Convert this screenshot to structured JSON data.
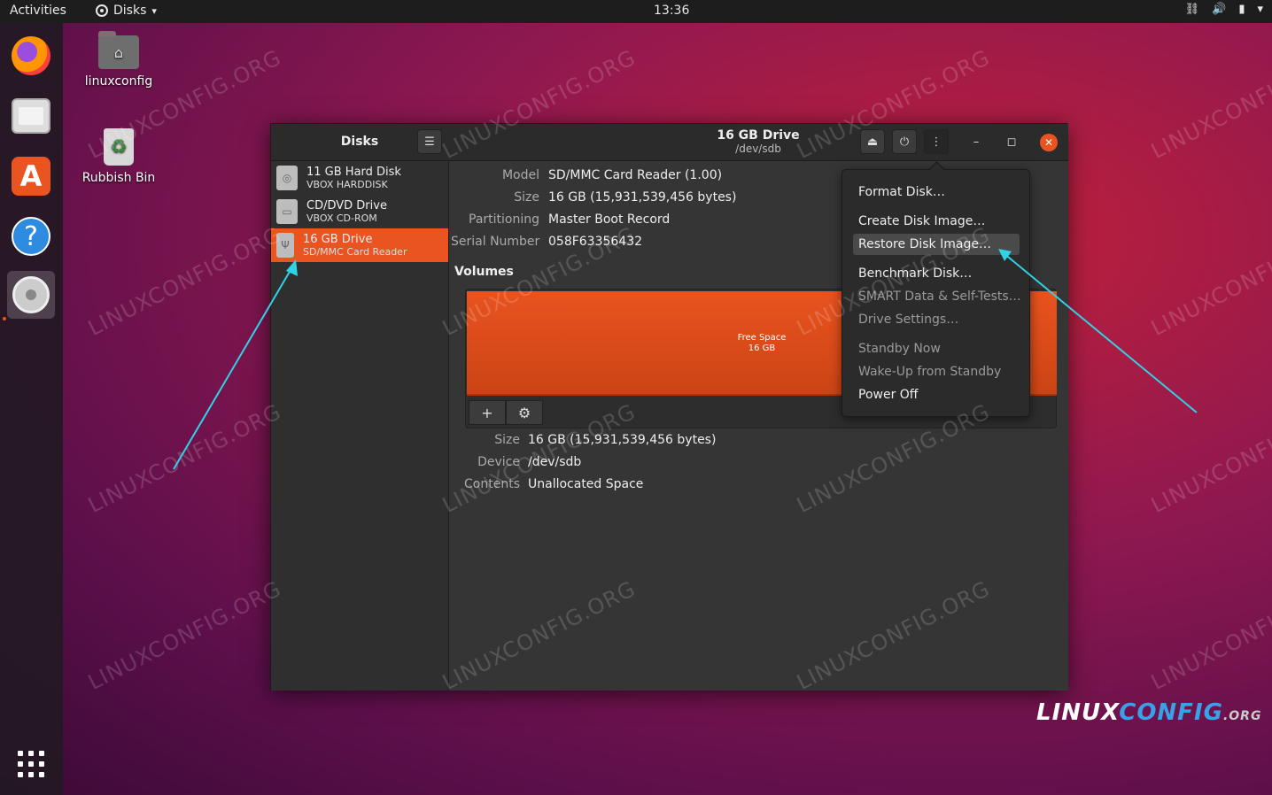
{
  "topbar": {
    "activities": "Activities",
    "app_name": "Disks",
    "app_caret": "▾",
    "clock": "13:36",
    "tray": [
      "⛓",
      "🔊",
      "▮",
      "▾"
    ]
  },
  "desktop": {
    "home_folder_label": "linuxconfig",
    "trash_label": "Rubbish Bin"
  },
  "window": {
    "sidebar_title": "Disks",
    "drive_title": "16 GB Drive",
    "drive_subtitle": "/dev/sdb",
    "drives": [
      {
        "name": "11 GB Hard Disk",
        "desc": "VBOX HARDDISK"
      },
      {
        "name": "CD/DVD Drive",
        "desc": "VBOX CD-ROM"
      },
      {
        "name": "16 GB Drive",
        "desc": "SD/MMC Card  Reader"
      }
    ],
    "drive_props": [
      {
        "key": "Model",
        "value": "SD/MMC Card  Reader (1.00)"
      },
      {
        "key": "Size",
        "value": "16 GB (15,931,539,456 bytes)"
      },
      {
        "key": "Partitioning",
        "value": "Master Boot Record"
      },
      {
        "key": "Serial Number",
        "value": "058F63356432"
      }
    ],
    "volumes_label": "Volumes",
    "volume": {
      "line1": "Free Space",
      "line2": "16 GB"
    },
    "add_symbol": "+",
    "settings_symbol": "⚙",
    "partition_props": [
      {
        "key": "Size",
        "value": "16 GB (15,931,539,456 bytes)"
      },
      {
        "key": "Device",
        "value": "/dev/sdb"
      },
      {
        "key": "Contents",
        "value": "Unallocated Space"
      }
    ],
    "menu_items": [
      {
        "label": "Format Disk…"
      },
      {
        "label": "Create Disk Image…"
      },
      {
        "label": "Restore Disk Image…"
      },
      {
        "label": "Benchmark Disk…"
      },
      {
        "label": "SMART Data & Self-Tests…"
      },
      {
        "label": "Drive Settings…"
      },
      {
        "label": "Standby Now"
      },
      {
        "label": "Wake-Up from Standby"
      },
      {
        "label": "Power Off"
      }
    ]
  },
  "watermark": "LINUXCONFIG.ORG",
  "logo": {
    "part1": "LINUX",
    "part2": "CONFIG",
    "part3": ".ORG"
  },
  "colors": {
    "accent": "#e95420",
    "arrow": "#2fd3e6"
  }
}
